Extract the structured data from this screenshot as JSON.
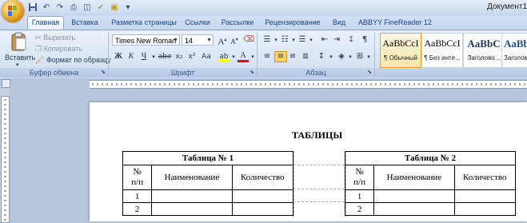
{
  "window": {
    "title": "Документ1"
  },
  "quick_access": [
    "save-icon",
    "undo-icon",
    "redo-icon",
    "quick-print-icon",
    "print-preview-icon",
    "spelling-icon",
    "open-icon",
    "customize-icon"
  ],
  "tabs": [
    {
      "label": "Главная",
      "active": true
    },
    {
      "label": "Вставка"
    },
    {
      "label": "Разметка страницы"
    },
    {
      "label": "Ссылки"
    },
    {
      "label": "Рассылки"
    },
    {
      "label": "Рецензирование"
    },
    {
      "label": "Вид"
    },
    {
      "label": "ABBYY FineReader 12"
    }
  ],
  "clipboard": {
    "paste": "Вставить",
    "cut": "Вырезать",
    "copy": "Копировать",
    "format_painter": "Формат по образцу",
    "label": "Буфер обмена"
  },
  "font": {
    "name": "Times New Roman",
    "size": "14",
    "label": "Шрифт",
    "bold": "Ж",
    "italic": "К",
    "underline": "Ч",
    "strike": "abe",
    "subscript": "x₂",
    "superscript": "x²",
    "change_case": "Aa",
    "grow": "A",
    "shrink": "A",
    "highlight": "ab",
    "font_color": "A"
  },
  "paragraph": {
    "label": "Абзац"
  },
  "styles": [
    {
      "sample": "AaBbCcI",
      "name": "¶ Обычный",
      "selected": true
    },
    {
      "sample": "AaBbCcI",
      "name": "¶ Без инте..."
    },
    {
      "sample": "AaBbC",
      "name": "Заголово..."
    },
    {
      "sample": "AaBbC",
      "name": "Заголово"
    }
  ],
  "document": {
    "heading": "ТАБЛИЦЫ",
    "tables": [
      {
        "caption": "Таблица № 1",
        "headers": [
          "№ п/п",
          "Наименование",
          "Количество"
        ],
        "rows": [
          [
            "1",
            "",
            ""
          ],
          [
            "2",
            "",
            ""
          ]
        ]
      },
      {
        "caption": "Таблица № 2",
        "headers": [
          "№ п/п",
          "Наименование",
          "Количество"
        ],
        "rows": [
          [
            "1",
            "",
            ""
          ],
          [
            "2",
            "",
            ""
          ]
        ]
      }
    ]
  },
  "colors": {
    "ribbon": "#dbe6f4",
    "tab_text": "#15428b",
    "highlight_yellow": "#ffff00",
    "font_red": "#ff0000"
  }
}
